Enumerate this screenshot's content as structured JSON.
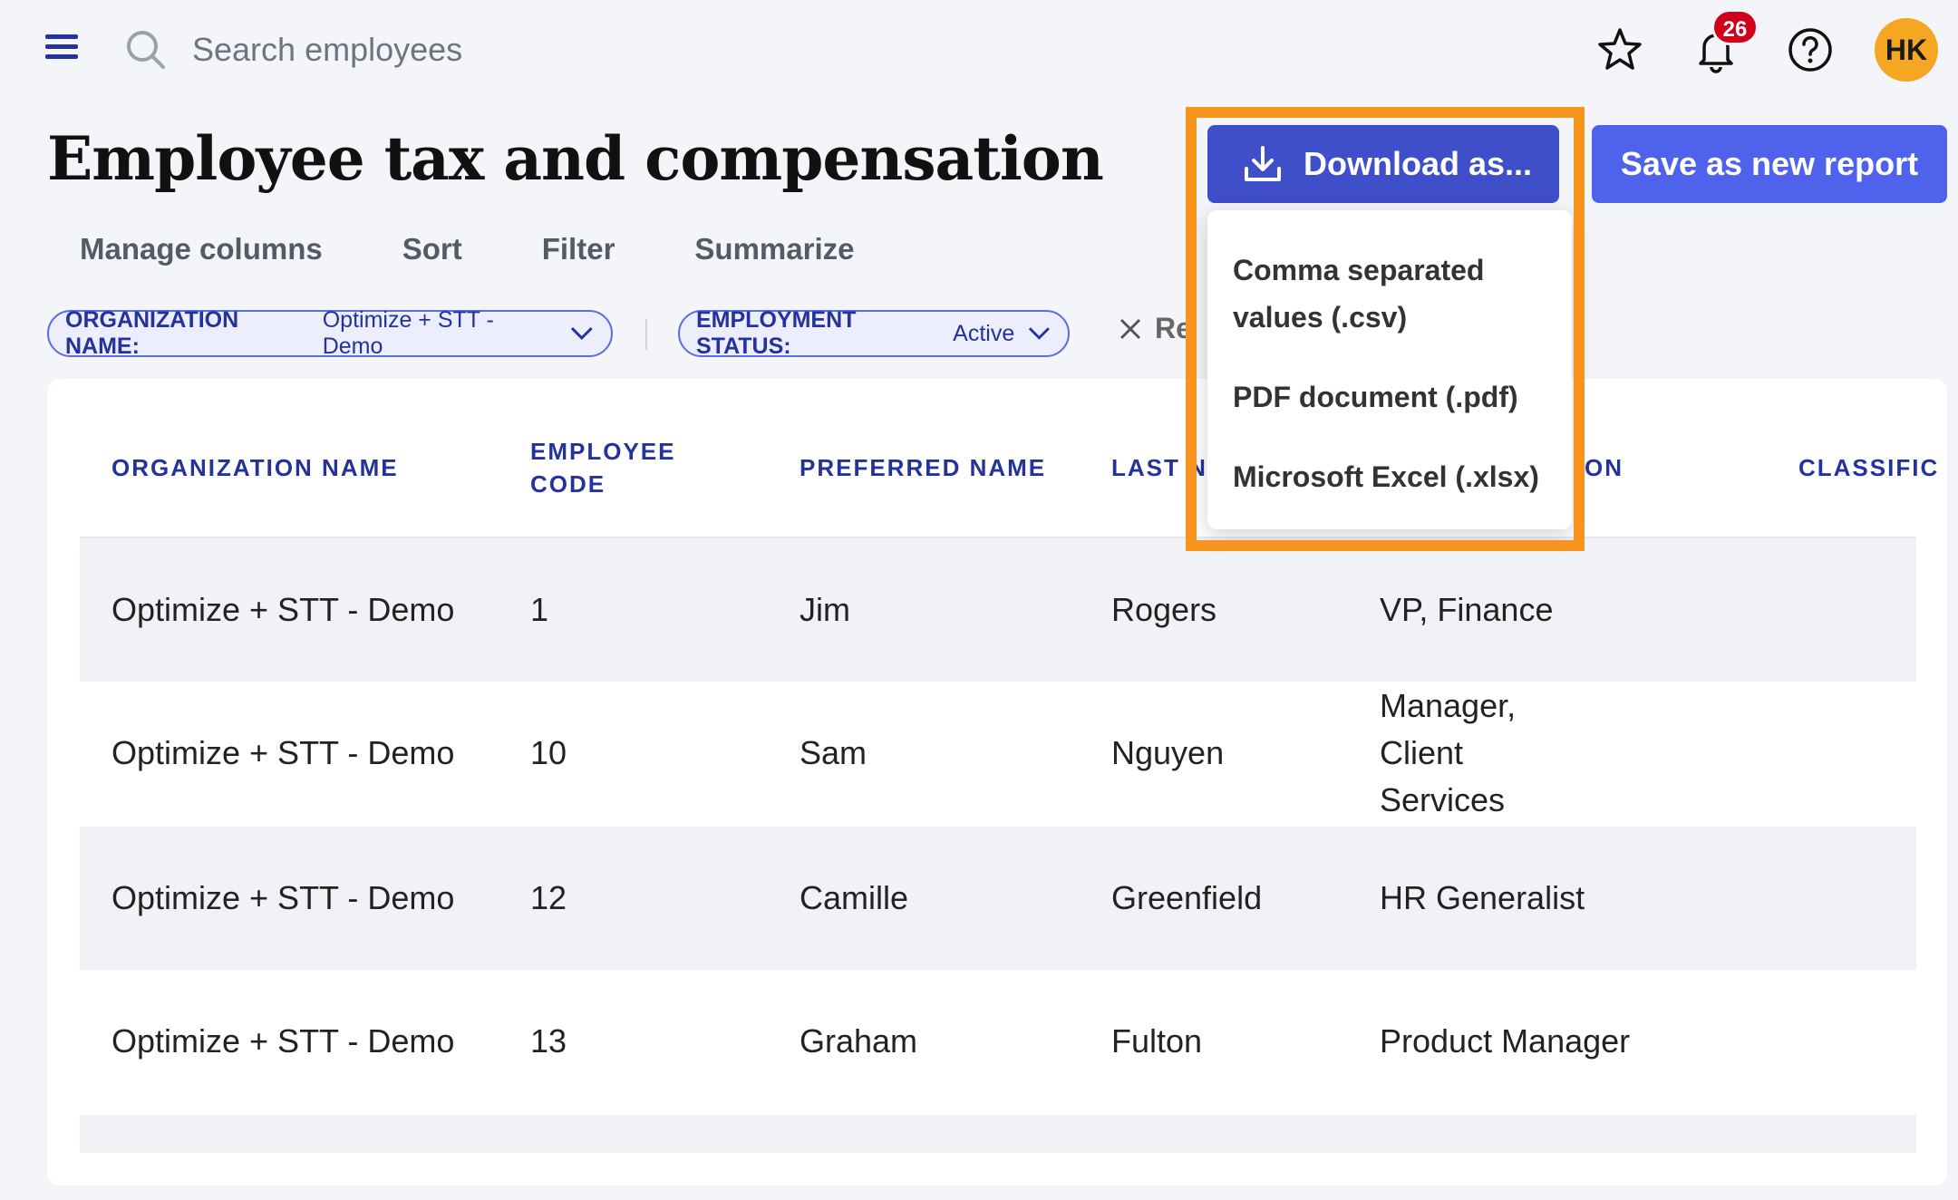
{
  "search": {
    "placeholder": "Search employees"
  },
  "header": {
    "notification_count": "26",
    "avatar_initials": "HK"
  },
  "page": {
    "title": "Employee tax and compensation"
  },
  "actions": {
    "download_label": "Download as...",
    "save_label": "Save as new report"
  },
  "download_menu": {
    "items": [
      {
        "label": "Comma separated values (.csv)"
      },
      {
        "label": "PDF document (.pdf)"
      },
      {
        "label": "Microsoft Excel (.xlsx)"
      }
    ]
  },
  "toolbar": {
    "items": [
      "Manage columns",
      "Sort",
      "Filter",
      "Summarize"
    ]
  },
  "filters": [
    {
      "key": "ORGANIZATION NAME:",
      "value": "Optimize + STT - Demo"
    },
    {
      "key": "EMPLOYMENT STATUS:",
      "value": "Active"
    }
  ],
  "remove_filters_label": "Re",
  "table": {
    "columns": [
      "ORGANIZATION NAME",
      "EMPLOYEE CODE",
      "PREFERRED NAME",
      "LAST N",
      "ON",
      "CLASSIFIC"
    ],
    "rows": [
      [
        "Optimize + STT - Demo",
        "1",
        "Jim",
        "Rogers",
        "VP, Finance"
      ],
      [
        "Optimize + STT - Demo",
        "10",
        "Sam",
        "Nguyen",
        "Manager, Client Services"
      ],
      [
        "Optimize + STT - Demo",
        "12",
        "Camille",
        "Greenfield",
        "HR Generalist"
      ],
      [
        "Optimize + STT - Demo",
        "13",
        "Graham",
        "Fulton",
        "Product Manager"
      ]
    ]
  },
  "colors": {
    "accent": "#4a5ae0",
    "highlight": "#f7941d",
    "header_text": "#23339b",
    "badge": "#d0021b",
    "avatar": "#f5a623"
  }
}
